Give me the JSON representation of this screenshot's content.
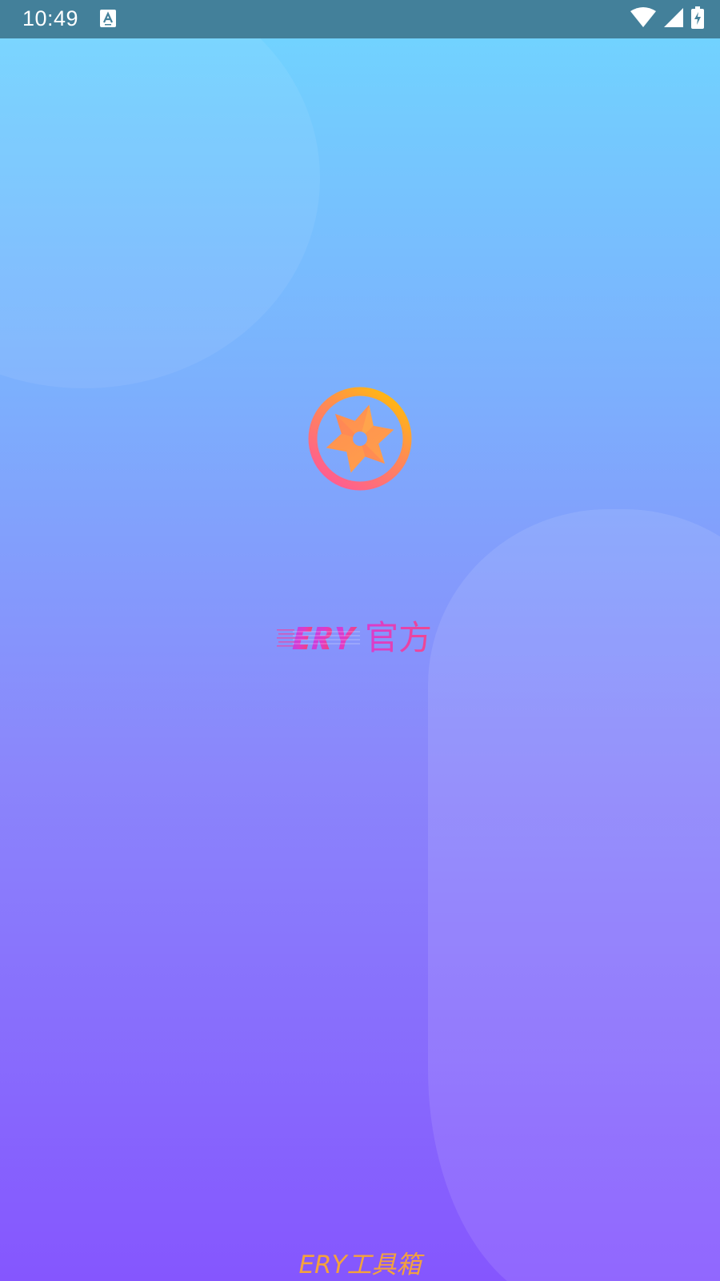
{
  "status_bar": {
    "time": "10:49",
    "notification_icon": "font-a-icon",
    "right_icons": [
      "wifi-icon",
      "cellular-signal-icon",
      "battery-charging-icon"
    ],
    "background": "#43809a"
  },
  "splash": {
    "logo_icon": "compass-star-logo-icon",
    "brand_latin": "ERY",
    "brand_cn": "官方",
    "footer_title": "ERY工具箱"
  },
  "colors": {
    "gradient_top": "#70d6ff",
    "gradient_bottom": "#8556fe",
    "logo_ring_top": "#ffc400",
    "logo_ring_bottom": "#ff5f8e",
    "brand_pink": "#e93cb9",
    "footer_orange": "#f4a23c"
  }
}
